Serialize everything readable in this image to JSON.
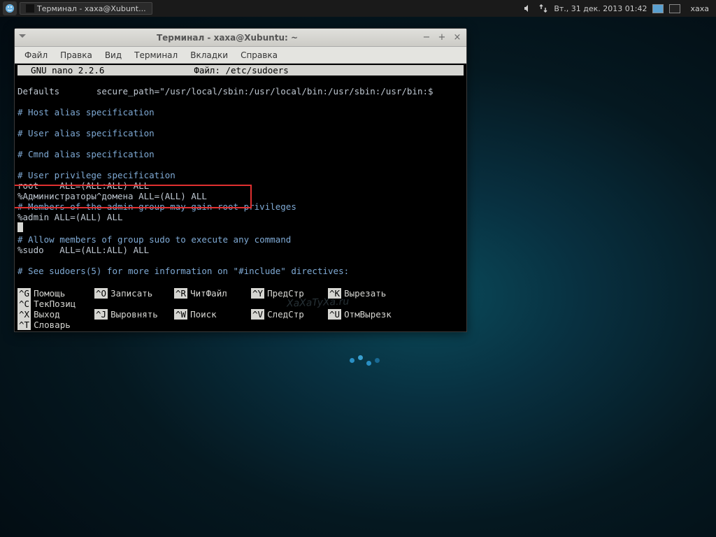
{
  "taskbar": {
    "app_label": "Терминал - xaxa@Xubunt...",
    "datetime": "Вт., 31 дек. 2013 01:42",
    "user": "xaxa"
  },
  "window": {
    "title": "Терминал - xaxa@Xubuntu: ~",
    "menus": [
      "Файл",
      "Правка",
      "Вид",
      "Терминал",
      "Вкладки",
      "Справка"
    ]
  },
  "nano": {
    "header_left": "  GNU nano 2.2.6",
    "header_mid": "Файл: /etc/sudoers",
    "lines": [
      "",
      "Defaults       secure_path=\"/usr/local/sbin:/usr/local/bin:/usr/sbin:/usr/bin:$",
      "",
      "# Host alias specification",
      "",
      "# User alias specification",
      "",
      "# Cmnd alias specification",
      "",
      "# User privilege specification",
      "root    ALL=(ALL:ALL) ALL",
      "%Администраторы^домена ALL=(ALL) ALL",
      "# Members of the admin group may gain root privileges",
      "%admin ALL=(ALL) ALL",
      "",
      "# Allow members of group sudo to execute any command",
      "%sudo   ALL=(ALL:ALL) ALL",
      "",
      "# See sudoers(5) for more information on \"#include\" directives:",
      ""
    ],
    "highlighted_line_index": 11,
    "shortcuts_row1": [
      {
        "key": "^G",
        "label": "Помощь"
      },
      {
        "key": "^O",
        "label": "Записать"
      },
      {
        "key": "^R",
        "label": "ЧитФайл"
      },
      {
        "key": "^Y",
        "label": "ПредСтр"
      },
      {
        "key": "^K",
        "label": "Вырезать"
      },
      {
        "key": "^C",
        "label": "ТекПозиц"
      }
    ],
    "shortcuts_row2": [
      {
        "key": "^X",
        "label": "Выход"
      },
      {
        "key": "^J",
        "label": "Выровнять"
      },
      {
        "key": "^W",
        "label": "Поиск"
      },
      {
        "key": "^V",
        "label": "СледСтр"
      },
      {
        "key": "^U",
        "label": "ОтмВырезк"
      },
      {
        "key": "^T",
        "label": "Словарь"
      }
    ]
  },
  "watermark": "XaXaTyXa.ru"
}
